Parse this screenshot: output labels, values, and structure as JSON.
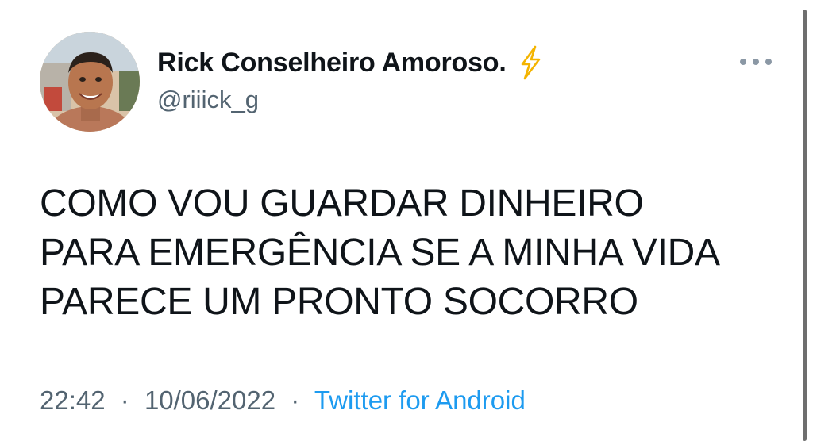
{
  "tweet": {
    "author": {
      "display_name": "Rick Conselheiro Amoroso.",
      "handle": "@riiick_g",
      "badge_icon": "lightning-bolt-icon",
      "badge_color": "#f4b400"
    },
    "more_icon": "more-horizontal-icon",
    "text": "COMO VOU GUARDAR DINHEIRO\nPARA EMERGÊNCIA SE A MINHA VIDA\nPARECE UM PRONTO SOCORRO",
    "time": "22:42",
    "separator": "·",
    "date": "10/06/2022",
    "source": "Twitter for Android",
    "link_color": "#1d9bf0"
  }
}
